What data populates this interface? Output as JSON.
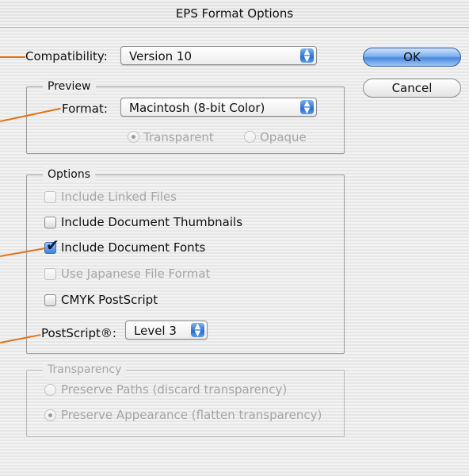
{
  "window": {
    "title": "EPS Format Options"
  },
  "compatibility": {
    "label": "Compatibility:",
    "value": "Version 10"
  },
  "buttons": {
    "ok": "OK",
    "cancel": "Cancel"
  },
  "preview": {
    "title": "Preview",
    "format_label": "Format:",
    "format_value": "Macintosh (8-bit Color)",
    "transparent": "Transparent",
    "opaque": "Opaque"
  },
  "options": {
    "title": "Options",
    "linked_files": "Include Linked Files",
    "thumbnails": "Include Document Thumbnails",
    "fonts": "Include Document Fonts",
    "japanese": "Use Japanese File Format",
    "cmyk": "CMYK PostScript",
    "postscript_label": "PostScript®:",
    "postscript_value": "Level 3"
  },
  "transparency": {
    "title": "Transparency",
    "paths": "Preserve Paths (discard transparency)",
    "appearance": "Preserve Appearance (flatten transparency)"
  },
  "colors": {
    "callout": "#e1731a",
    "accent": "#2a6fd0"
  }
}
